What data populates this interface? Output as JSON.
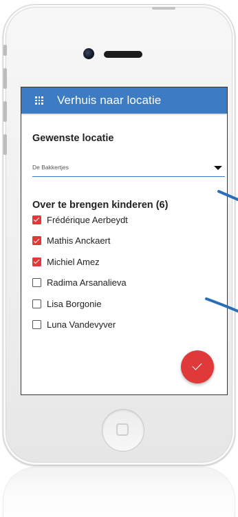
{
  "app_bar": {
    "title": "Verhuis naar locatie",
    "menu_icon": "grid-icon",
    "color": "#3d7cc3"
  },
  "location_section": {
    "title": "Gewenste locatie",
    "dropdown": {
      "selected": "De Bakkertjes",
      "caret_icon": "caret-down-icon"
    }
  },
  "children_section": {
    "title": "Over te brengen kinderen (6)",
    "children": [
      {
        "name": "Frédérique Aerbeydt",
        "checked": true
      },
      {
        "name": "Mathis Anckaert",
        "checked": true
      },
      {
        "name": "Michiel Amez",
        "checked": true
      },
      {
        "name": "Radima Arsanalieva",
        "checked": false
      },
      {
        "name": "Lisa Borgonie",
        "checked": false
      },
      {
        "name": "Luna Vandevyver",
        "checked": false
      }
    ]
  },
  "confirm_button": {
    "icon": "checkmark-icon",
    "color": "#e0393a"
  }
}
